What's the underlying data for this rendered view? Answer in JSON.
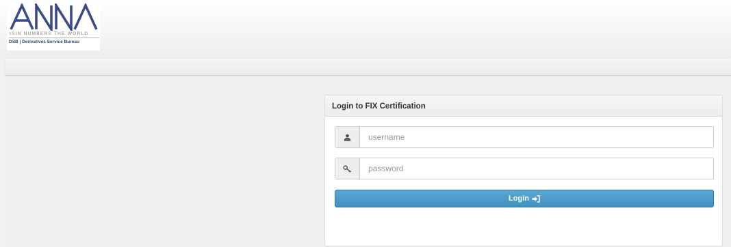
{
  "logo": {
    "mark": "ANNA",
    "tagline": "ISIN NUMBERS THE WORLD",
    "subtitle": "DSB | Derivatives Service Bureau"
  },
  "login": {
    "title": "Login to FIX Certification",
    "username_placeholder": "username",
    "password_placeholder": "password",
    "button_label": "Login",
    "icons": {
      "username": "user-icon",
      "password": "key-icon",
      "button": "sign-in-icon"
    }
  },
  "colors": {
    "button": "#4a9acb",
    "logo_text": "#2a3f73"
  }
}
